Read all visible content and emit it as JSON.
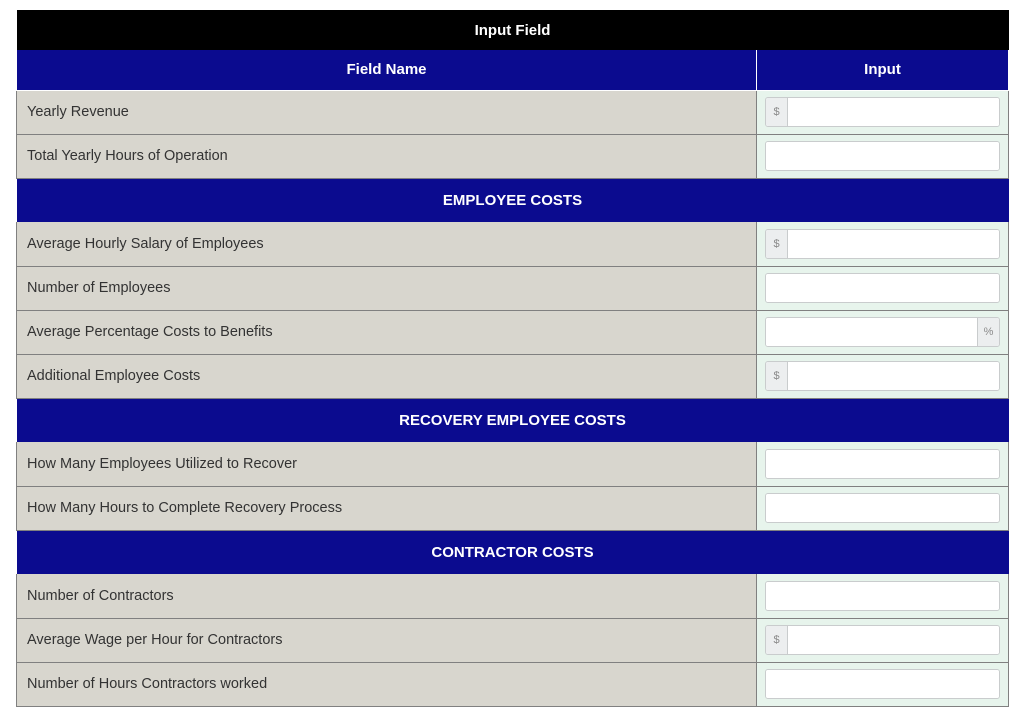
{
  "title": "Input Field",
  "columns": {
    "name": "Field Name",
    "input": "Input"
  },
  "symbols": {
    "dollar": "$",
    "percent": "%"
  },
  "intro_rows": [
    {
      "label": "Yearly Revenue",
      "prefix": "dollar",
      "value": ""
    },
    {
      "label": "Total Yearly Hours of Operation",
      "value": ""
    }
  ],
  "sections": [
    {
      "heading": "EMPLOYEE COSTS",
      "rows": [
        {
          "label": "Average Hourly Salary of Employees",
          "prefix": "dollar",
          "value": ""
        },
        {
          "label": "Number of Employees",
          "value": ""
        },
        {
          "label": "Average Percentage Costs to Benefits",
          "suffix": "percent",
          "value": ""
        },
        {
          "label": "Additional Employee Costs",
          "prefix": "dollar",
          "value": ""
        }
      ]
    },
    {
      "heading": "RECOVERY EMPLOYEE COSTS",
      "rows": [
        {
          "label": "How Many Employees Utilized to Recover",
          "value": ""
        },
        {
          "label": "How Many Hours to Complete Recovery Process",
          "value": ""
        }
      ]
    },
    {
      "heading": "CONTRACTOR COSTS",
      "rows": [
        {
          "label": "Number of Contractors",
          "value": ""
        },
        {
          "label": "Average Wage per Hour for Contractors",
          "prefix": "dollar",
          "value": ""
        },
        {
          "label": "Number of Hours Contractors worked",
          "value": ""
        }
      ]
    }
  ]
}
